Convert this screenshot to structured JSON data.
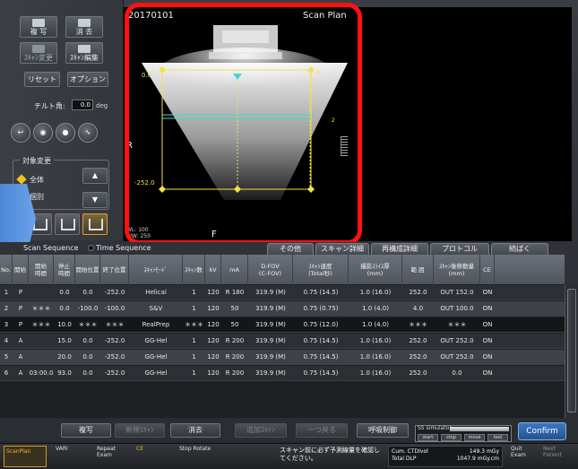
{
  "left_panel": {
    "copy_label": "複 写",
    "delete_label": "消 去",
    "scan_change_label": "ｽｷｬﾝ変更",
    "scan_edit_label": "ｽｷｬﾝ編集",
    "reset_label": "リセット",
    "option_label": "オプション",
    "tilt_label": "チルト角:",
    "tilt_value": "0.0",
    "tilt_unit": "deg",
    "target_change_label": "対象変更",
    "all_label": "全体",
    "individual_label": "個別",
    "up_arrow": "▲",
    "down_arrow": "▼",
    "circle_buttons": [
      "↩",
      "◉",
      "●",
      "∿"
    ]
  },
  "view": {
    "date": "20170101",
    "label": "Scan Plan",
    "right_marker": "R",
    "foot_marker": "F",
    "wl": "WL: 100",
    "ww": "WW: 250",
    "top_position": "0.0",
    "bottom_position": "-252.0",
    "right_number": "6",
    "mid_number": "2"
  },
  "tabs": {
    "scan_sequence": "Scan Sequence",
    "time_sequence": "Time Sequence",
    "right_tabs": [
      "その他",
      "スキャン詳細",
      "再構成詳細",
      "プロトコル",
      "続ぱく"
    ]
  },
  "table": {
    "headers": [
      "No.",
      "開始",
      "開始\n時間",
      "停止\n時間",
      "開始位置",
      "終了位置",
      "ｽｷｬﾝﾓｰﾄﾞ",
      "ｽｷｬﾝ数",
      "kV",
      "mA",
      "D-FOV\n(C-FOV)",
      "ｽｷｬﾝ速度\n(Total秒)",
      "撮影ｽﾗｲｽ厚\n(mm)",
      "範 囲",
      "ｽｷｬﾝ後移動量\n(mm)",
      "CE"
    ],
    "rows": [
      [
        "1",
        "P",
        "",
        "0.0",
        "0.0",
        "-252.0",
        "Helical",
        "1",
        "120",
        "R 180",
        "319.9 (M)",
        "0.75 (14.5)",
        "1.0 (16.0)",
        "252.0",
        "OUT 152.0",
        "ON"
      ],
      [
        "2",
        "P",
        "＊＊＊",
        "0.0",
        "-100.0",
        "-100.0",
        "S&V",
        "1",
        "120",
        "50",
        "319.9 (M)",
        "0.75 (0.75)",
        "1.0 (4.0)",
        "4.0",
        "OUT 100.0",
        "ON"
      ],
      [
        "3",
        "P",
        "＊＊＊",
        "10.0",
        "＊＊＊",
        "＊＊＊",
        "RealPrep",
        "＊＊＊",
        "120",
        "50",
        "319.9 (M)",
        "0.75 (12.0)",
        "1.0 (4.0)",
        "＊＊＊",
        "＊＊＊",
        "ON"
      ],
      [
        "4",
        "A",
        "",
        "15.0",
        "0.0",
        "-252.0",
        "GG-Hel",
        "1",
        "120",
        "R 200",
        "319.9 (M)",
        "0.75 (14.5)",
        "1.0 (16.0)",
        "252.0",
        "OUT 252.0",
        "ON"
      ],
      [
        "5",
        "A",
        "",
        "20.0",
        "0.0",
        "-252.0",
        "GG-Hel",
        "1",
        "120",
        "R 200",
        "319.9 (M)",
        "0.75 (14.5)",
        "1.0 (16.0)",
        "252.0",
        "OUT 252.0",
        "ON"
      ],
      [
        "6",
        "A",
        "03:00.0",
        "93.0",
        "0.0",
        "-252.0",
        "GG-Hel",
        "1",
        "120",
        "R 200",
        "319.9 (M)",
        "0.75 (14.5)",
        "1.0 (16.0)",
        "252.0",
        "0.0",
        "ON"
      ]
    ]
  },
  "actions": {
    "copy": "複写",
    "new_scan": "新規ｽｷｬﾝ",
    "delete": "消去",
    "add_scan": "追加ｽｷｬﾝ",
    "undo": "一つ戻る",
    "breath_control": "呼吸制御",
    "sim_title": "SS simulator",
    "sim_start": "start",
    "sim_stop": "stop",
    "sim_move": "move",
    "sim_test": "test",
    "confirm": "Confirm"
  },
  "status": {
    "scanplan": "ScanPlan",
    "vari": "VARI",
    "repeat_exam": "Repeat Exam",
    "ce": "CE",
    "stop_rotate": "Stop Rotate",
    "message": "スキャン前に必ず予測線量を確認してください。",
    "ctdi_label": "Cum. CTDIvol",
    "ctdi_value": "149.3 mGy",
    "dlp_label": "Total DLP",
    "dlp_value": "1047.9 mGy.cm",
    "quit_exam": "Quit Exam",
    "next_patient": "Next Patient"
  },
  "colors": {
    "accent_red": "#ff1111",
    "confirm_blue": "#2f68b0",
    "marker_yellow": "#f0e24a",
    "line_cyan": "#3fd8d0",
    "pointer_blue": "#5b95e0"
  }
}
